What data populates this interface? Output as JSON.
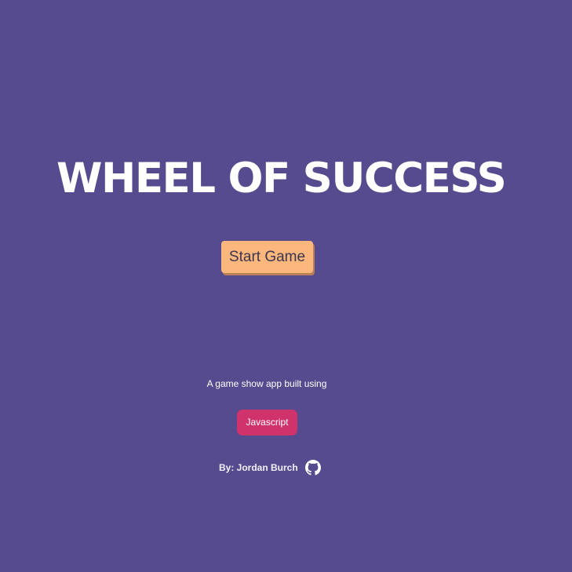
{
  "header": {
    "title": "WHEEL OF SUCCESS"
  },
  "main": {
    "start_button_label": "Start Game"
  },
  "footer": {
    "tagline": "A game show app built using",
    "tech_badge_label": "Javascript",
    "byline": "By: Jordan Burch",
    "github_icon": "github-icon"
  },
  "colors": {
    "background": "#554b8e",
    "start_button": "#fbb77c",
    "tech_badge": "#d0326b",
    "text": "#ffffff"
  }
}
